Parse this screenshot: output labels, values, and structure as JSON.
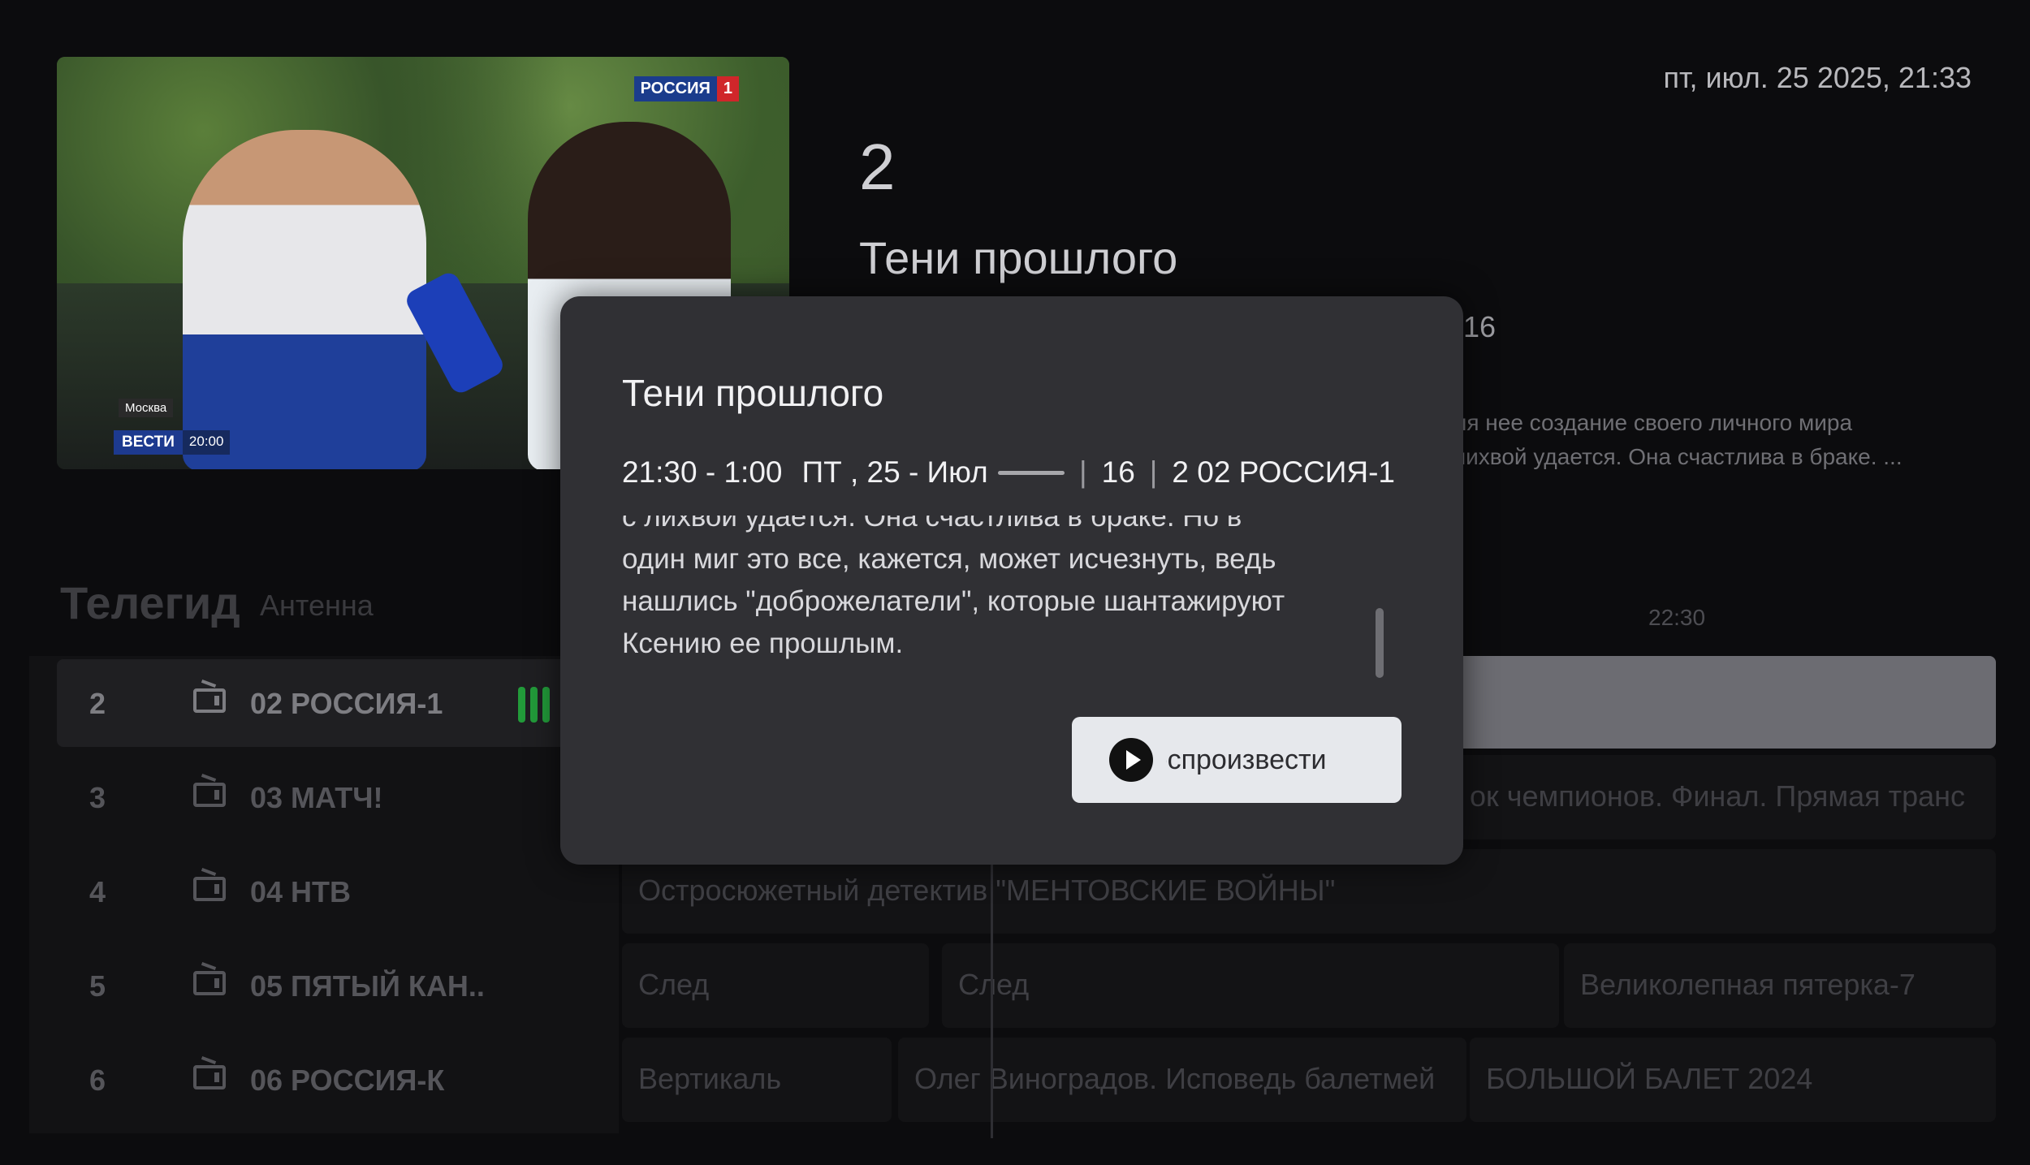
{
  "header": {
    "clock": "пт, июл. 25 2025, 21:33"
  },
  "program": {
    "number": "2",
    "title": "Тени прошлого",
    "age": "16",
    "desc_line1": "ля нее  создание своего личного мира",
    "desc_line2": "пихвой удается. Она счастлива в браке. ..."
  },
  "video": {
    "channel_logo_text": "РОССИЯ",
    "channel_logo_num": "1",
    "location": "Москва",
    "news_name": "ВЕСТИ",
    "news_time": "20:00"
  },
  "guide": {
    "title": "Телегид",
    "subtitle": "Антенна",
    "time_marker": "22:30",
    "channels": [
      {
        "num": "2",
        "name": "02 РОССИЯ-1",
        "active": true
      },
      {
        "num": "3",
        "name": "03 МАТЧ!"
      },
      {
        "num": "4",
        "name": "04 НТВ"
      },
      {
        "num": "5",
        "name": "05 ПЯТЫЙ КАН.."
      },
      {
        "num": "6",
        "name": "06 РОССИЯ-К"
      }
    ],
    "epg": {
      "row3": "ок чемпионов. Финал. Прямая транс",
      "row4": "Остросюжетный детектив \"МЕНТОВСКИЕ ВОЙНЫ\"",
      "row5": [
        "След",
        "След",
        "Великолепная пятерка-7"
      ],
      "row6": [
        "Вертикаль",
        "Олег Виноградов. Исповедь балетмей",
        "БОЛЬШОЙ БАЛЕТ  2024"
      ]
    }
  },
  "modal": {
    "title": "Тени прошлого",
    "time": "21:30 - 1:00",
    "date": "ПТ , 25 - Июл",
    "age": "16",
    "channel": "2 02 РОССИЯ-1",
    "description": [
      "с лихвой удается. Она счастлива в браке. Но в",
      "один миг это все, кажется, может исчезнуть, ведь",
      "нашлись \"доброжелатели\", которые шантажируют",
      "Ксению ее прошлым."
    ],
    "play_label": "Воспроизвести"
  }
}
